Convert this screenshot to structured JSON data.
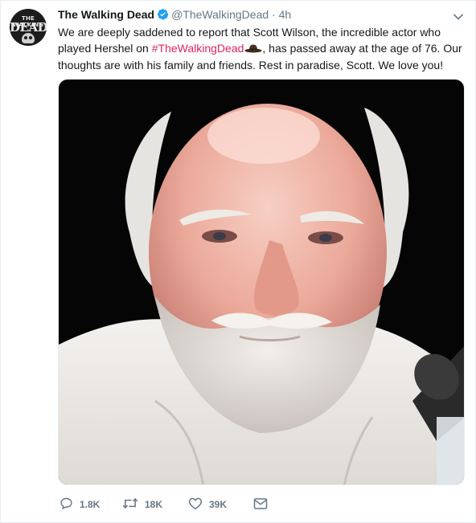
{
  "tweet": {
    "display_name": "The Walking Dead",
    "handle": "@TheWalkingDead",
    "separator": "·",
    "time": "4h",
    "text_before": "We are deeply saddened to report that Scott Wilson, the incredible actor who played Hershel on ",
    "hashtag": "#TheWalkingDead",
    "text_after": ", has passed away at the age of 76. Our thoughts are with his family and friends. Rest in paradise, Scott. We love you!"
  },
  "avatar": {
    "logo_top": "THE WALKING",
    "logo_main": "DEAD"
  },
  "actions": {
    "replies": "1.8K",
    "retweets": "18K",
    "likes": "39K"
  },
  "icons": [
    "verified-icon",
    "chevron-down-icon",
    "cowboy-hat-icon",
    "reply-icon",
    "retweet-icon",
    "like-icon",
    "message-icon"
  ],
  "colors": {
    "hashtag": "#e0245e",
    "verified": "#1da1f2",
    "muted": "#657786"
  }
}
